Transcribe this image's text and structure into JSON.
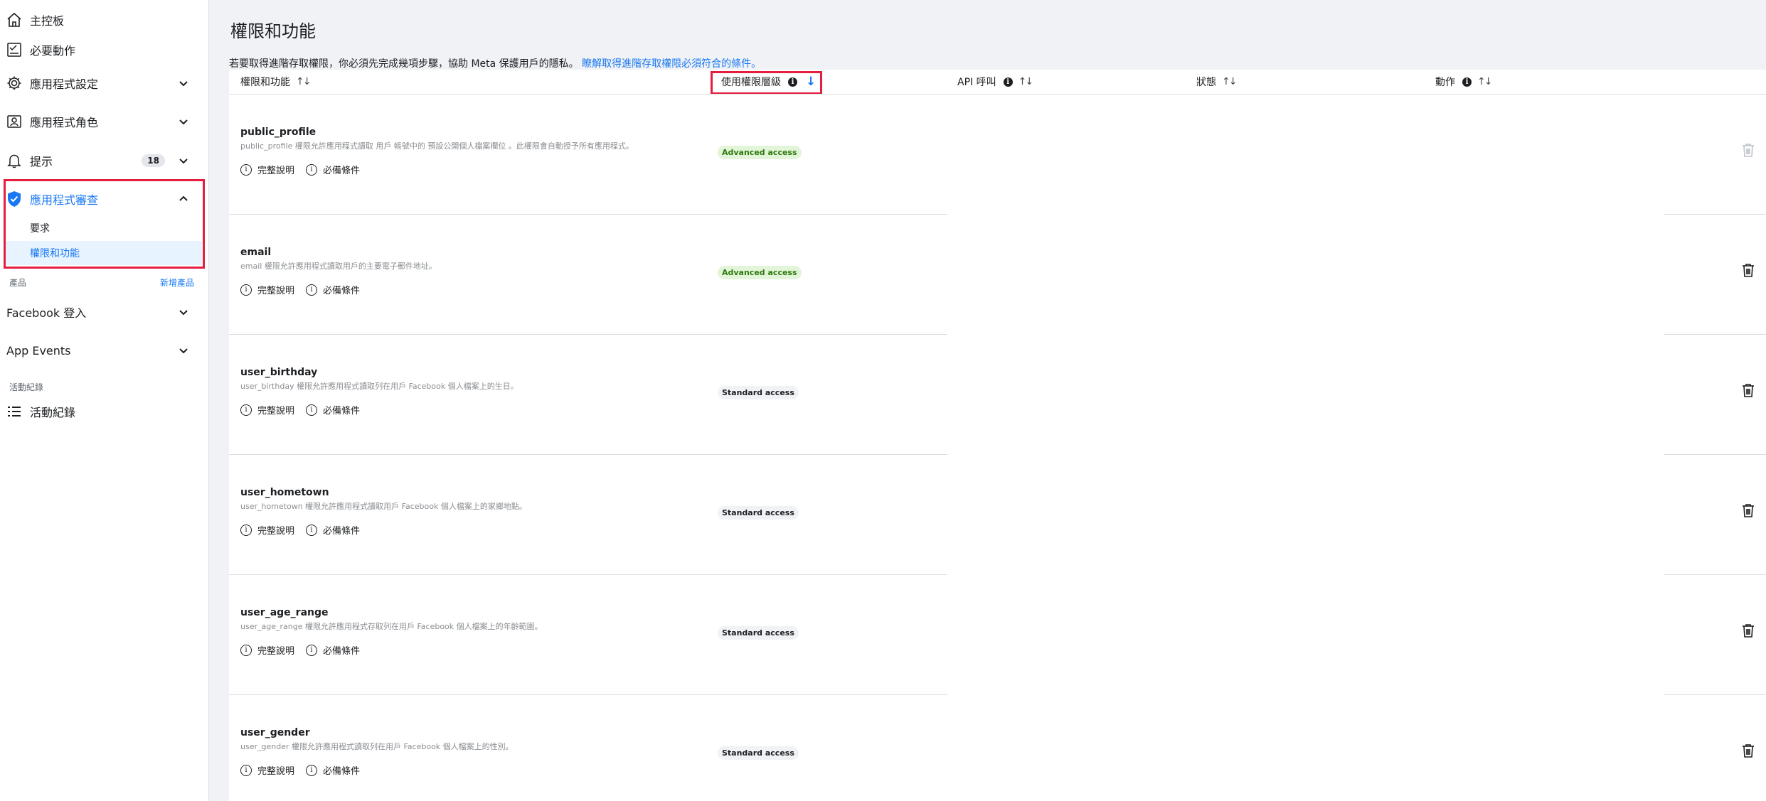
{
  "sidebar": {
    "items": [
      {
        "label": "主控板",
        "icon": "home-icon"
      },
      {
        "label": "必要動作",
        "icon": "checklist-icon"
      },
      {
        "label": "應用程式設定",
        "icon": "gear-icon"
      },
      {
        "label": "應用程式角色",
        "icon": "roles-icon"
      },
      {
        "label": "提示",
        "icon": "bell-icon",
        "badge": "18"
      },
      {
        "label": "應用程式審查",
        "icon": "shield-check-icon"
      }
    ],
    "review_subitems": [
      {
        "label": "要求"
      },
      {
        "label": "權限和功能"
      }
    ],
    "products_section": {
      "title": "產品",
      "add_link": "新增產品"
    },
    "product_items": [
      {
        "label": "Facebook 登入"
      },
      {
        "label": "App Events"
      }
    ],
    "activity_section": {
      "title": "活動紀錄"
    },
    "activity_item": {
      "label": "活動紀錄",
      "icon": "list-icon"
    }
  },
  "main": {
    "title": "權限和功能",
    "notice_text": "若要取得進階存取權限，你必須先完成幾項步驟，協助 Meta 保護用戶的隱私。",
    "notice_link": "瞭解取得進階存取權限必須符合的條件。"
  },
  "table": {
    "headers": {
      "permission": "權限和功能",
      "access_level": "使用權限層級",
      "api_calls": "API 呼叫",
      "status": "狀態",
      "actions": "動作"
    },
    "rows": [
      {
        "name": "public_profile",
        "description": "public_profile 權限允許應用程式讀取 用戶 帳號中的 預設公開個人檔案欄位 。此權限會自動授予所有應用程式。",
        "access": "Advanced access",
        "access_type": "advanced",
        "link1": "完整說明",
        "link2": "必備條件",
        "delete_disabled": true
      },
      {
        "name": "email",
        "description": "email 權限允許應用程式讀取用戶的主要電子郵件地址。",
        "access": "Advanced access",
        "access_type": "advanced",
        "link1": "完整說明",
        "link2": "必備條件",
        "delete_disabled": false
      },
      {
        "name": "user_birthday",
        "description": "user_birthday 權限允許應用程式讀取列在用戶 Facebook 個人檔案上的生日。",
        "access": "Standard access",
        "access_type": "standard",
        "link1": "完整說明",
        "link2": "必備條件",
        "delete_disabled": false
      },
      {
        "name": "user_hometown",
        "description": "user_hometown 權限允許應用程式讀取用戶 Facebook 個人檔案上的家鄉地點。",
        "access": "Standard access",
        "access_type": "standard",
        "link1": "完整說明",
        "link2": "必備條件",
        "delete_disabled": false
      },
      {
        "name": "user_age_range",
        "description": "user_age_range 權限允許應用程式存取列在用戶 Facebook 個人檔案上的年齡範圍。",
        "access": "Standard access",
        "access_type": "standard",
        "link1": "完整說明",
        "link2": "必備條件",
        "delete_disabled": false
      },
      {
        "name": "user_gender",
        "description": "user_gender 權限允許應用程式讀取列在用戶 Facebook 個人檔案上的性別。",
        "access": "Standard access",
        "access_type": "standard",
        "link1": "完整說明",
        "link2": "必備條件",
        "delete_disabled": false
      }
    ]
  },
  "colors": {
    "accent": "#1877f2",
    "highlight": "#e41e3f",
    "advanced_bg": "#e3f5d8",
    "advanced_text": "#2d7a0d"
  }
}
